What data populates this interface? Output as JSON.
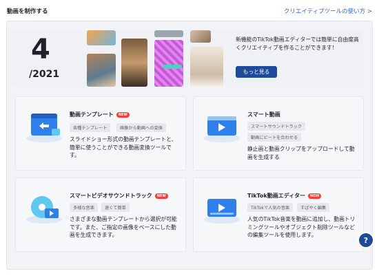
{
  "header": {
    "title": "動画を制作する",
    "guide_link": "クリエイティブツールの使い方 >"
  },
  "banner": {
    "date_num": "4",
    "date_year": "/2021",
    "description": "新機能のTikTok動画エディターでは簡単に自由度高くクリエイティブを作ることができます！",
    "button_label": "もっと見る"
  },
  "cards": [
    {
      "title": "動画テンプレート",
      "badge": "NEW",
      "tags": [
        "各種テンプレート",
        "画像から動画への変換"
      ],
      "description": "スライドショー形式の動画テンプレートと、簡単に使うことができる動画変換ツールです。",
      "icon": "template-icon"
    },
    {
      "title": "スマート動画",
      "badge": "",
      "tags": [
        "スマートサウンドトラック",
        "動画にビートを合わせる"
      ],
      "description": "静止画と動画クリップをアップロードして動画を生成する",
      "icon": "smart-video-icon"
    },
    {
      "title": "スマートビデオサウンドトラック",
      "badge": "NEW",
      "tags": [
        "多様な音楽",
        "速くて簡単"
      ],
      "description": "さまざまな動画テンプレートから選択が可能です。また、ご指定の画像をベースにした動画を生成できます。",
      "icon": "soundtrack-icon"
    },
    {
      "title": "TikTok動画エディター",
      "badge": "NEW",
      "tags": [
        "TikTokで人気の音楽",
        "すばやく編集"
      ],
      "description": "人気のTikTok音楽を動画に追加し、動画トリミングツールやオブジェクト削除ツールなどの編集ツールを使用します。",
      "icon": "video-editor-icon"
    }
  ],
  "help": {
    "label": "?",
    "icon": "help-icon"
  },
  "colors": {
    "accent": "#1d4b9a",
    "link": "#2c64d8",
    "badge": "#ff3b30"
  }
}
